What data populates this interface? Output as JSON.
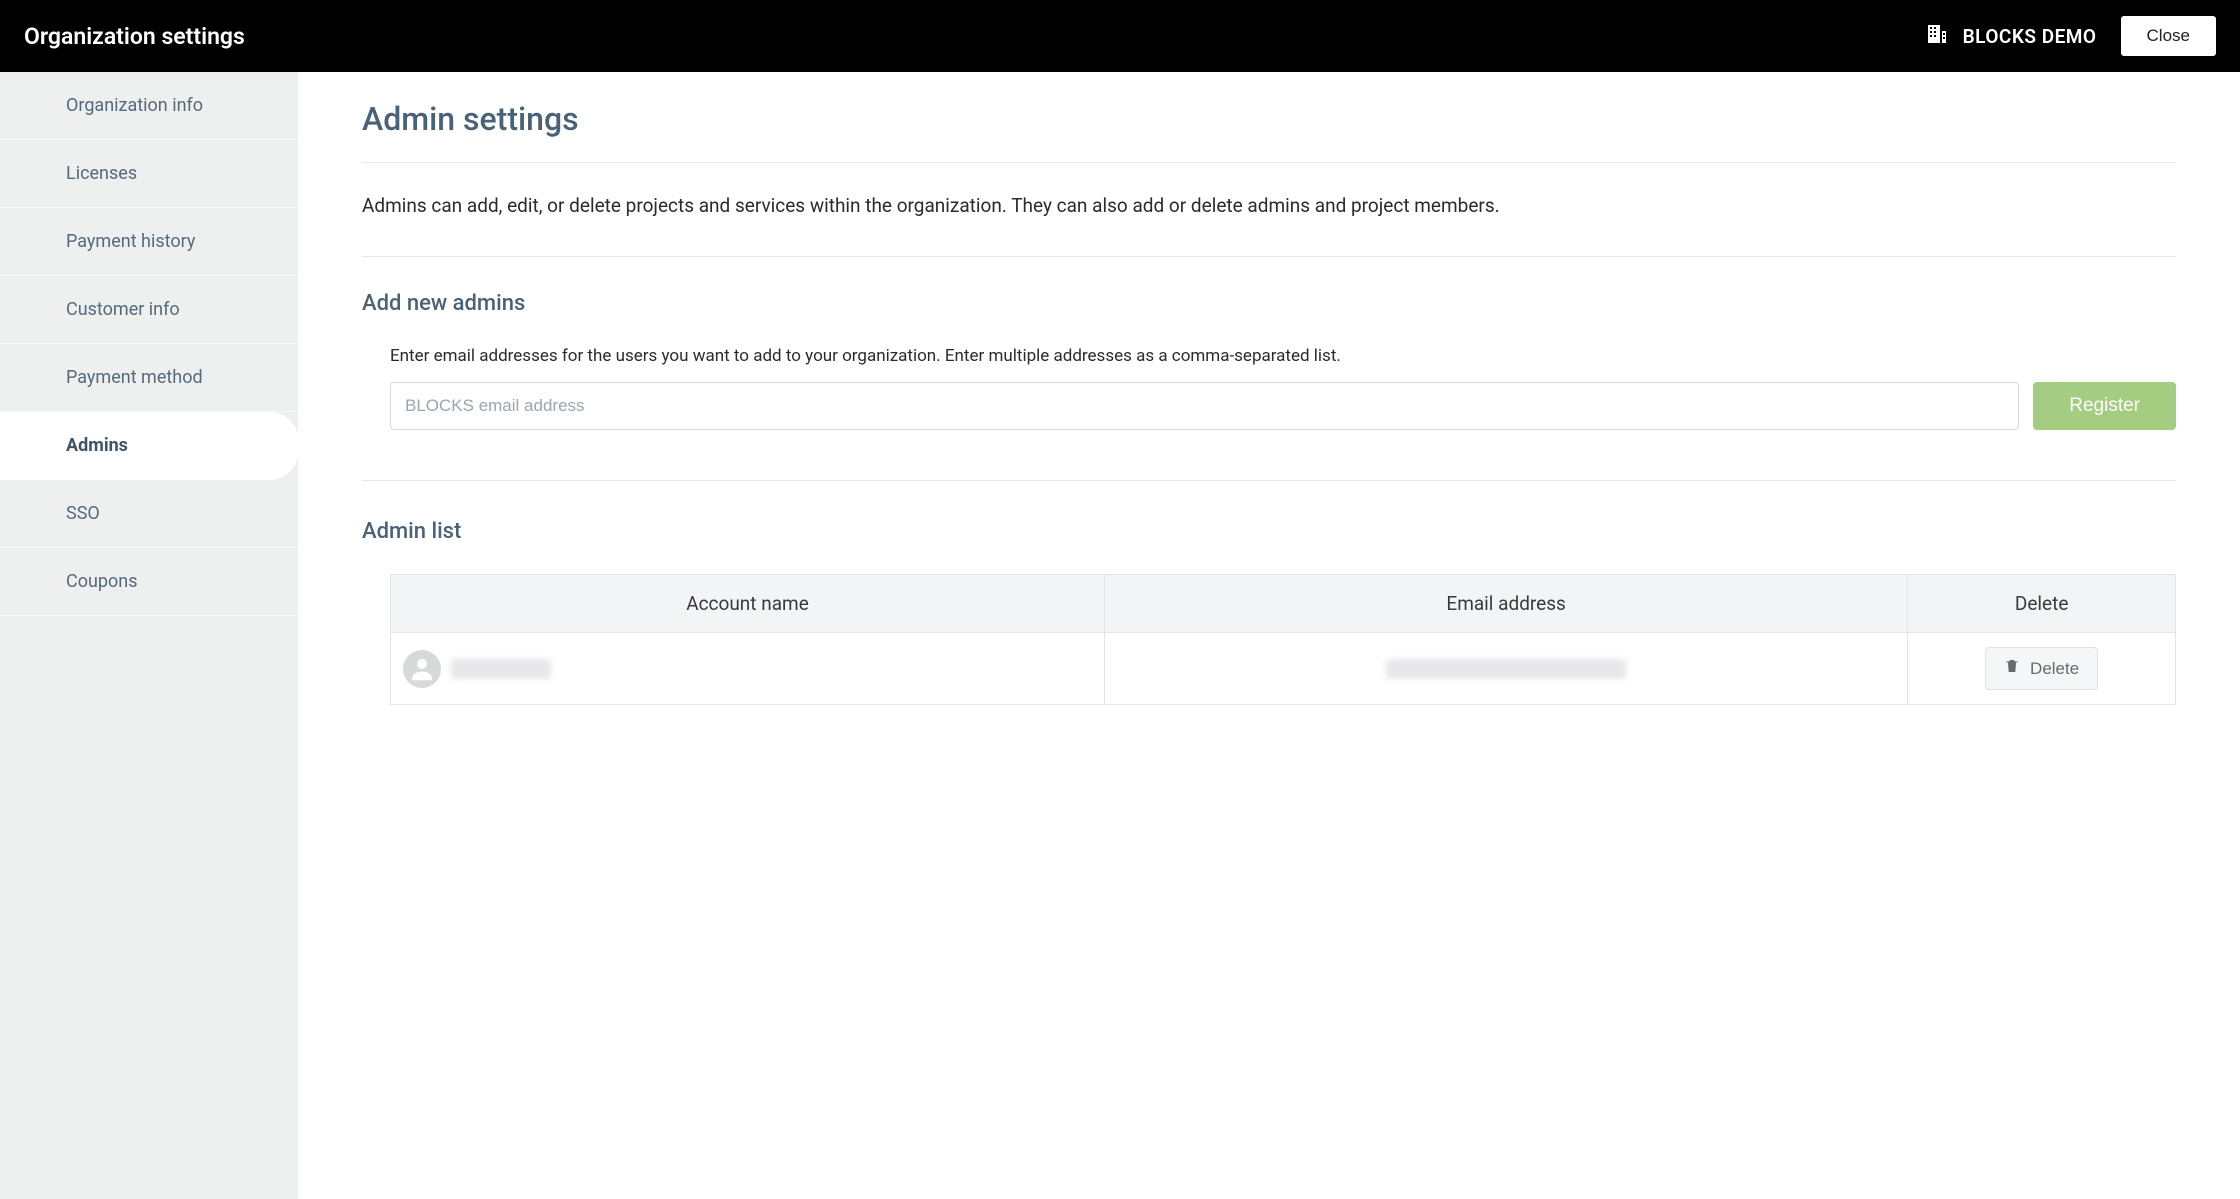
{
  "header": {
    "title": "Organization settings",
    "org_name": "BLOCKS DEMO",
    "close_label": "Close"
  },
  "sidebar": {
    "items": [
      {
        "label": "Organization info",
        "active": false
      },
      {
        "label": "Licenses",
        "active": false
      },
      {
        "label": "Payment history",
        "active": false
      },
      {
        "label": "Customer info",
        "active": false
      },
      {
        "label": "Payment method",
        "active": false
      },
      {
        "label": "Admins",
        "active": true
      },
      {
        "label": "SSO",
        "active": false
      },
      {
        "label": "Coupons",
        "active": false
      }
    ]
  },
  "main": {
    "page_title": "Admin settings",
    "description": "Admins can add, edit, or delete projects and services within the organization. They can also add or delete admins and project members.",
    "add_section": {
      "heading": "Add new admins",
      "instruction": "Enter email addresses for the users you want to add to your organization. Enter multiple addresses as a comma-separated list.",
      "input_placeholder": "BLOCKS email address",
      "register_label": "Register"
    },
    "list_section": {
      "heading": "Admin list",
      "columns": {
        "account": "Account name",
        "email": "Email address",
        "delete": "Delete"
      },
      "rows": [
        {
          "account_name": "",
          "email": "",
          "delete_label": "Delete"
        }
      ]
    }
  }
}
